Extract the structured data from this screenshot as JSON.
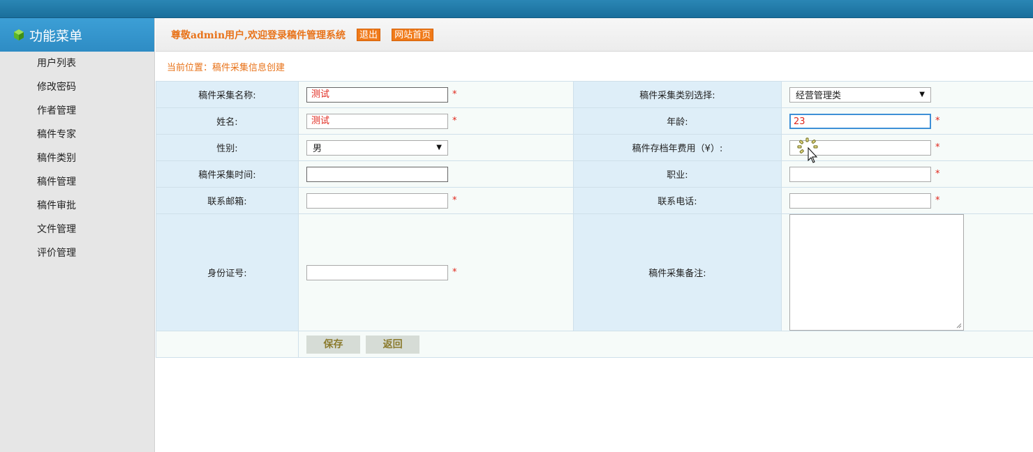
{
  "sidebar": {
    "title": "功能菜单",
    "items": [
      {
        "label": "用户列表"
      },
      {
        "label": "修改密码"
      },
      {
        "label": "作者管理"
      },
      {
        "label": "稿件专家"
      },
      {
        "label": "稿件类别"
      },
      {
        "label": "稿件管理"
      },
      {
        "label": "稿件审批"
      },
      {
        "label": "文件管理"
      },
      {
        "label": "评价管理"
      }
    ]
  },
  "header": {
    "welcome": "尊敬admin用户,欢迎登录稿件管理系统",
    "logout_label": "退出",
    "home_label": "网站首页"
  },
  "breadcrumb": "当前位置：稿件采集信息创建",
  "form": {
    "name_label": "稿件采集名称:",
    "name_value": "测试",
    "category_label": "稿件采集类别选择:",
    "category_value": "经营管理类",
    "person_label": "姓名:",
    "person_value": "测试",
    "age_label": "年龄:",
    "age_value": "23",
    "gender_label": "性别:",
    "gender_value": "男",
    "fee_label": "稿件存档年费用（¥）:",
    "fee_value": "",
    "time_label": "稿件采集时间:",
    "time_value": "",
    "job_label": "职业:",
    "job_value": "",
    "email_label": "联系邮箱:",
    "email_value": "",
    "phone_label": "联系电话:",
    "phone_value": "",
    "idcard_label": "身份证号:",
    "idcard_value": "",
    "remark_label": "稿件采集备注:",
    "required_mark": "*",
    "save_label": "保存",
    "back_label": "返回"
  },
  "colors": {
    "accent": "#e8731a",
    "topbar": "#1a6f9c",
    "required": "#e0261b"
  }
}
